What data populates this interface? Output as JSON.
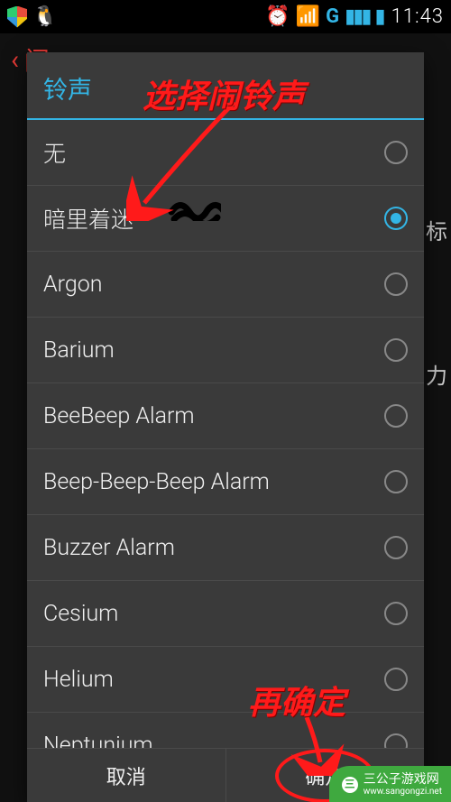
{
  "status": {
    "alarm_icon": "⏰",
    "wifi_icon": "📶",
    "net_label": "G",
    "signal_icon": "▮▮▮",
    "battery_icon": "▮",
    "time": "11:43"
  },
  "underlay": {
    "back_title_char": "闹",
    "edge_char_1": "标",
    "edge_char_2": "力"
  },
  "dialog": {
    "title": "铃声",
    "items": [
      {
        "label": "无",
        "selected": false
      },
      {
        "label": "暗里着迷",
        "selected": true
      },
      {
        "label": "Argon",
        "selected": false
      },
      {
        "label": "Barium",
        "selected": false
      },
      {
        "label": "BeeBeep Alarm",
        "selected": false
      },
      {
        "label": "Beep-Beep-Beep Alarm",
        "selected": false
      },
      {
        "label": "Buzzer Alarm",
        "selected": false
      },
      {
        "label": "Cesium",
        "selected": false
      },
      {
        "label": "Helium",
        "selected": false
      },
      {
        "label": "Neptunium",
        "selected": false
      }
    ],
    "cancel": "取消",
    "confirm": "确定"
  },
  "annotations": {
    "select_ringtone": "选择闹铃声",
    "then_confirm": "再确定"
  },
  "watermark": {
    "line1": "三公子游戏网",
    "line2": "www.sangongzi.net"
  }
}
